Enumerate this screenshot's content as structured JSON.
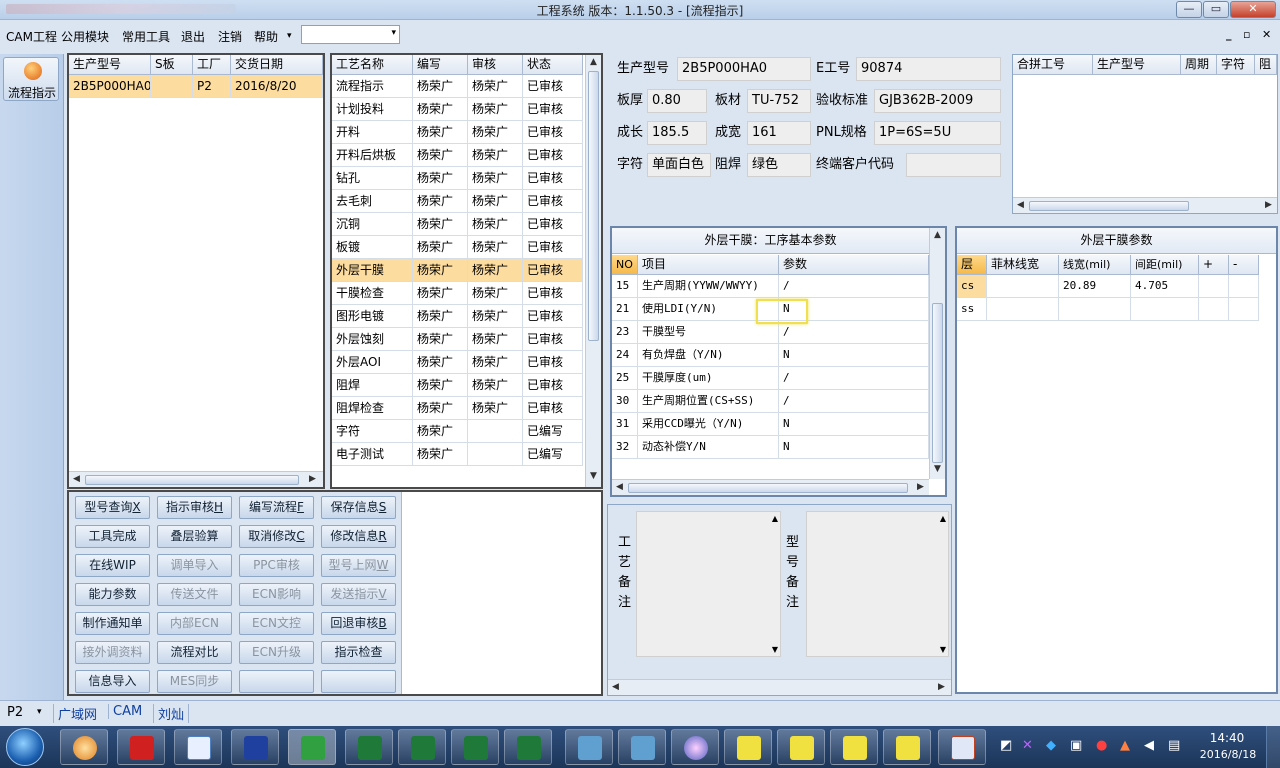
{
  "window": {
    "title": "工程系统   版本：1.1.50.3 - [流程指示]",
    "min_label": "—",
    "restore_label": "▭",
    "close_label": "✕"
  },
  "menu": {
    "items": [
      "CAM工程",
      "公用模块",
      "常用工具",
      "退出",
      "注销",
      "帮助"
    ],
    "help_arrow": "▾",
    "select_value": "",
    "mdi_controls": [
      "_",
      "▫",
      "✕"
    ]
  },
  "sidebar": {
    "flow_button_label": "流程指示"
  },
  "model_list": {
    "headers": [
      "生产型号",
      "S板",
      "工厂",
      "交货日期"
    ],
    "rows": [
      [
        "2B5P000HA0",
        "",
        "P2",
        "2016/8/20"
      ]
    ]
  },
  "process_list": {
    "headers": [
      "工艺名称",
      "编写",
      "审核",
      "状态"
    ],
    "rows": [
      [
        "流程指示",
        "杨荣广",
        "杨荣广",
        "已审核"
      ],
      [
        "计划投料",
        "杨荣广",
        "杨荣广",
        "已审核"
      ],
      [
        "开料",
        "杨荣广",
        "杨荣广",
        "已审核"
      ],
      [
        "开料后烘板",
        "杨荣广",
        "杨荣广",
        "已审核"
      ],
      [
        "钻孔",
        "杨荣广",
        "杨荣广",
        "已审核"
      ],
      [
        "去毛刺",
        "杨荣广",
        "杨荣广",
        "已审核"
      ],
      [
        "沉铜",
        "杨荣广",
        "杨荣广",
        "已审核"
      ],
      [
        "板镀",
        "杨荣广",
        "杨荣广",
        "已审核"
      ],
      [
        "外层干膜",
        "杨荣广",
        "杨荣广",
        "已审核"
      ],
      [
        "干膜检查",
        "杨荣广",
        "杨荣广",
        "已审核"
      ],
      [
        "图形电镀",
        "杨荣广",
        "杨荣广",
        "已审核"
      ],
      [
        "外层蚀刻",
        "杨荣广",
        "杨荣广",
        "已审核"
      ],
      [
        "外层AOI",
        "杨荣广",
        "杨荣广",
        "已审核"
      ],
      [
        "阻焊",
        "杨荣广",
        "杨荣广",
        "已审核"
      ],
      [
        "阻焊检查",
        "杨荣广",
        "杨荣广",
        "已审核"
      ],
      [
        "字符",
        "杨荣广",
        "",
        "已编写"
      ],
      [
        "电子测试",
        "杨荣广",
        "",
        "已编写"
      ]
    ],
    "selected_index": 8
  },
  "buttons": [
    {
      "label": "型号查询",
      "key": "X",
      "enabled": true
    },
    {
      "label": "指示审核",
      "key": "H",
      "enabled": true
    },
    {
      "label": "编写流程",
      "key": "F",
      "enabled": true
    },
    {
      "label": "保存信息",
      "key": "S",
      "enabled": true
    },
    {
      "label": "工具完成",
      "key": "",
      "enabled": true
    },
    {
      "label": "叠层验算",
      "key": "",
      "enabled": true
    },
    {
      "label": "取消修改",
      "key": "C",
      "enabled": true
    },
    {
      "label": "修改信息",
      "key": "R",
      "enabled": true
    },
    {
      "label": "在线WIP",
      "key": "",
      "enabled": true
    },
    {
      "label": "调单导入",
      "key": "",
      "enabled": false
    },
    {
      "label": "PPC审核",
      "key": "",
      "enabled": false
    },
    {
      "label": "型号上网",
      "key": "W",
      "enabled": false
    },
    {
      "label": "能力参数",
      "key": "",
      "enabled": true
    },
    {
      "label": "传送文件",
      "key": "",
      "enabled": false
    },
    {
      "label": "ECN影响",
      "key": "",
      "enabled": false
    },
    {
      "label": "发送指示",
      "key": "V",
      "enabled": false
    },
    {
      "label": "制作通知单",
      "key": "",
      "enabled": true
    },
    {
      "label": "内部ECN",
      "key": "",
      "enabled": false
    },
    {
      "label": "ECN文控",
      "key": "",
      "enabled": false
    },
    {
      "label": "回退审核",
      "key": "B",
      "enabled": true
    },
    {
      "label": "接外调资料",
      "key": "",
      "enabled": false
    },
    {
      "label": "流程对比",
      "key": "",
      "enabled": true
    },
    {
      "label": "ECN升级",
      "key": "",
      "enabled": false
    },
    {
      "label": "指示检查",
      "key": "",
      "enabled": true
    },
    {
      "label": "信息导入",
      "key": "",
      "enabled": true
    },
    {
      "label": "MES同步",
      "key": "",
      "enabled": false
    },
    {
      "label": "",
      "key": "",
      "enabled": true
    },
    {
      "label": "",
      "key": "",
      "enabled": true
    }
  ],
  "info": {
    "model_label": "生产型号",
    "model_value": "2B5P000HA0",
    "e_label": "E工号",
    "e_value": "90874",
    "thick_label": "板厚",
    "thick_value": "0.80",
    "material_label": "板材",
    "material_value": "TU-752",
    "accept_label": "验收标准",
    "accept_value": "GJB362B-2009",
    "len_label": "成长",
    "len_value": "185.5",
    "wid_label": "成宽",
    "wid_value": "161",
    "pnl_label": "PNL规格",
    "pnl_value": "1P=6S=5U",
    "char_label": "字符",
    "char_value": "单面白色",
    "mask_label": "阻焊",
    "mask_value": "绿色",
    "cust_label": "终端客户代码",
    "cust_value": ""
  },
  "merge_table": {
    "headers": [
      "合拼工号",
      "生产型号",
      "周期",
      "字符",
      "阻焊"
    ]
  },
  "params": {
    "title": "外层干膜：工序基本参数",
    "headers": [
      "NO",
      "项目",
      "参数"
    ],
    "rows": [
      [
        "15",
        "生产周期(YYWW/WWYY)",
        "/"
      ],
      [
        "21",
        "使用LDI(Y/N)",
        "N"
      ],
      [
        "23",
        "干膜型号",
        "/"
      ],
      [
        "24",
        "有负焊盘（Y/N)",
        "N"
      ],
      [
        "25",
        "干膜厚度(um)",
        "/"
      ],
      [
        "30",
        "生产周期位置(CS+SS)",
        "/"
      ],
      [
        "31",
        "采用CCD曝光（Y/N)",
        "N"
      ],
      [
        "32",
        "动态补偿Y/N",
        "N"
      ]
    ]
  },
  "film": {
    "title": "外层干膜参数",
    "headers": [
      "层",
      "菲林线宽",
      "线宽(mil)",
      "间距(mil)",
      "+",
      "-"
    ],
    "rows": [
      [
        "cs",
        "",
        "20.89",
        "4.705",
        "",
        ""
      ],
      [
        "ss",
        "",
        "",
        "",
        "",
        ""
      ]
    ]
  },
  "notes": {
    "process_label": "工艺备注",
    "model_label": "型号备注"
  },
  "status": {
    "factory": "P2",
    "network": "广域网",
    "module": "CAM",
    "user": "刘灿"
  },
  "tray": {
    "time": "14:40",
    "date": "2016/8/18"
  },
  "colors": {
    "highlight": "#fddca0",
    "panel_border": "#4a4a4a",
    "window_bg": "#dbe5f1",
    "taskbar": "#1c3558"
  }
}
